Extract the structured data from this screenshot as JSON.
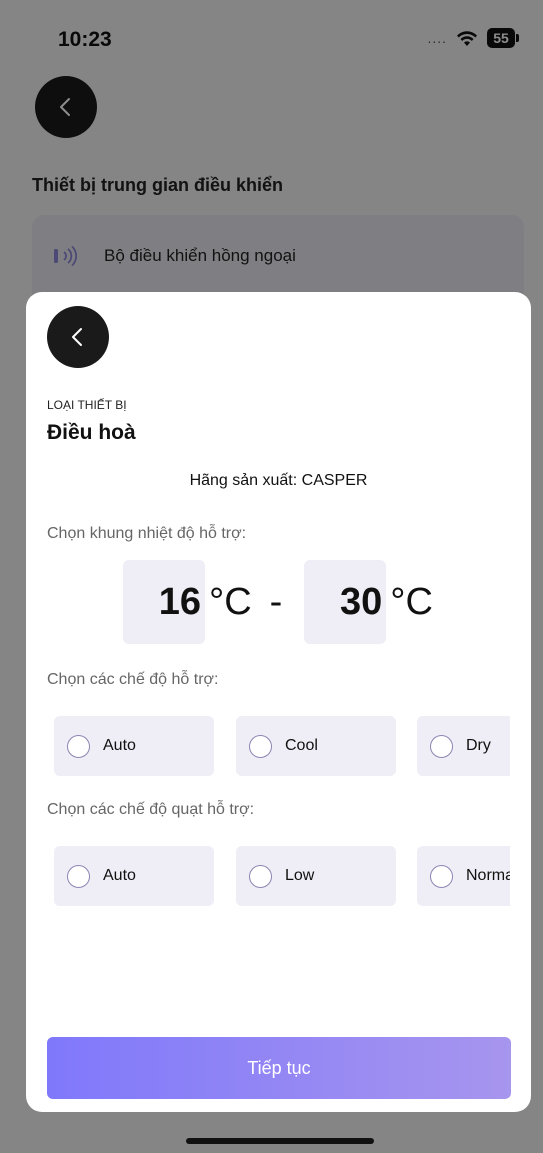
{
  "status_bar": {
    "time": "10:23",
    "signal": "....",
    "battery": "55"
  },
  "background_page": {
    "section_title": "Thiết bị trung gian điều khiển",
    "controller_label": "Bộ điều khiển hồng ngoại"
  },
  "sheet": {
    "kicker": "LOẠI THIẾT BỊ",
    "device_name": "Điều hoà",
    "manufacturer": "Hãng sản xuất: CASPER",
    "temperature": {
      "label": "Chọn khung nhiệt độ hỗ trợ:",
      "min": "16",
      "max": "30",
      "unit": "°C",
      "separator": "-"
    },
    "modes": {
      "label": "Chọn các chế độ hỗ trợ:",
      "options": [
        "Auto",
        "Cool",
        "Dry"
      ]
    },
    "fan_modes": {
      "label": "Chọn các chế độ quạt hỗ trợ:",
      "options": [
        "Auto",
        "Low",
        "Normal"
      ]
    },
    "continue_label": "Tiếp tục"
  },
  "colors": {
    "accent_start": "#7f78fb",
    "accent_end": "#a795ee",
    "option_bg": "#efedf5",
    "radio_border": "#8a86b3"
  }
}
